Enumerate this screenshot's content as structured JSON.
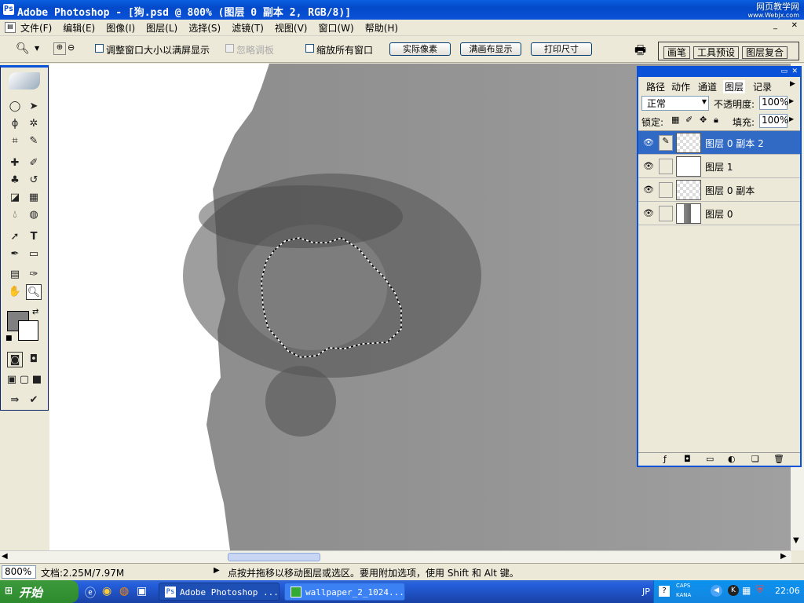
{
  "title": "Adobe Photoshop - [狗.psd @ 800% (图层 0 副本 2, RGB/8)]",
  "watermark": {
    "line1": "网页教学网",
    "line2": "www.Webjx.com"
  },
  "menu": [
    "文件(F)",
    "编辑(E)",
    "图像(I)",
    "图层(L)",
    "选择(S)",
    "滤镜(T)",
    "视图(V)",
    "窗口(W)",
    "帮助(H)"
  ],
  "options": {
    "resize_label": "调整窗口大小以满屏显示",
    "ignore_label": "忽略调板",
    "zoom_all_label": "缩放所有窗口",
    "actual_pixels": "实际像素",
    "fit_screen": "满画布显示",
    "print_size": "打印尺寸",
    "tabs": [
      "画笔",
      "工具预设",
      "图层复合"
    ]
  },
  "layers_panel": {
    "tabs": [
      "路径",
      "动作",
      "通道",
      "图层",
      "记录"
    ],
    "blend_mode": "正常",
    "opacity_label": "不透明度:",
    "opacity": "100%",
    "lock_label": "锁定:",
    "fill_label": "填充:",
    "fill": "100%",
    "layers": [
      {
        "name": "图层 0 副本 2",
        "selected": true
      },
      {
        "name": "图层 1",
        "selected": false
      },
      {
        "name": "图层 0 副本",
        "selected": false
      },
      {
        "name": "图层 0",
        "selected": false
      }
    ]
  },
  "status": {
    "zoom": "800%",
    "doc": "文档:2.25M/7.97M",
    "hint": "点按并拖移以移动图层或选区。要用附加选项，使用 Shift 和 Alt 键。"
  },
  "taskbar": {
    "start": "开始",
    "tasks": [
      "Adobe Photoshop ...",
      "wallpaper_2_1024..."
    ],
    "lang": "JP",
    "caps": "CAPS",
    "kana": "KANA",
    "time": "22:06"
  },
  "colors": {
    "title_blue": "#0349c9",
    "selection_blue": "#316ac5",
    "taskbar_blue": "#245edb",
    "start_green": "#2d8a2d"
  }
}
